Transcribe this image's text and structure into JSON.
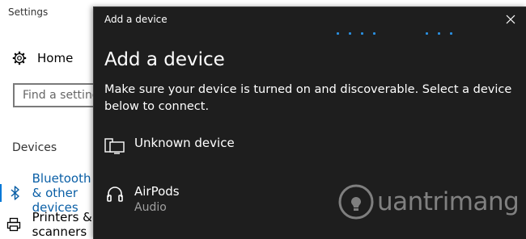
{
  "settings": {
    "window_title": "Settings",
    "home_label": "Home",
    "search_placeholder": "Find a setting",
    "section_label": "Devices",
    "nav": [
      {
        "label": "Bluetooth & other devices",
        "icon": "bluetooth-icon",
        "selected": true
      },
      {
        "label": "Printers & scanners",
        "icon": "printer-icon",
        "selected": false
      }
    ],
    "accent_color": "#0078d7"
  },
  "dialog": {
    "title": "Add a device",
    "heading": "Add a device",
    "description": "Make sure your device is turned on and discoverable. Select a device below to connect.",
    "close_icon": "close-icon",
    "devices": [
      {
        "name": "Unknown device",
        "type": "",
        "icon": "display-device-icon"
      },
      {
        "name": "AirPods",
        "type": "Audio",
        "icon": "headphones-icon"
      }
    ],
    "background_color": "#1e1e1e",
    "progress_color": "#2a8fe0"
  },
  "watermark": {
    "text": "uantrimang"
  }
}
